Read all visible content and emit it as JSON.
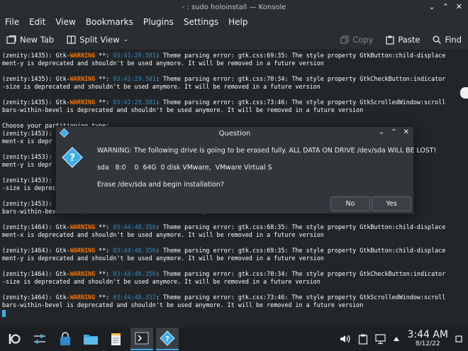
{
  "window": {
    "title": "- : sudo holoinstall — Konsole"
  },
  "menu": [
    "File",
    "Edit",
    "View",
    "Bookmarks",
    "Plugins",
    "Settings",
    "Help"
  ],
  "toolbar": {
    "new_tab": "New Tab",
    "split_view": "Split View",
    "copy": "Copy",
    "paste": "Paste",
    "find": "Find"
  },
  "terminal": {
    "lines": [
      {
        "pid": "(zenity:1435): Gtk-",
        "warn": "WARNING",
        "sep": " **: ",
        "ts": "03:41:29.581",
        "msg": ": Theme parsing error: gtk.css:69:35: The style property GtkButton:child-displace"
      },
      {
        "text": "ment-y is deprecated and shouldn't be used anymore. It will be removed in a future version"
      },
      {
        "text": ""
      },
      {
        "pid": "(zenity:1435): Gtk-",
        "warn": "WARNING",
        "sep": " **: ",
        "ts": "03:41:29.581",
        "msg": ": Theme parsing error: gtk.css:70:34: The style property GtkCheckButton:indicator"
      },
      {
        "text": "-size is deprecated and shouldn't be used anymore. It will be removed in a future version"
      },
      {
        "text": ""
      },
      {
        "pid": "(zenity:1435): Gtk-",
        "warn": "WARNING",
        "sep": " **: ",
        "ts": "03:41:29.581",
        "msg": ": Theme parsing error: gtk.css:73:46: The style property GtkScrolledWindow:scroll"
      },
      {
        "text": "bars-within-bevel is deprecated and shouldn't be used anymore. It will be removed in a future version"
      },
      {
        "text": ""
      },
      {
        "text": "Choose your partitioning type:"
      },
      {
        "text": "(zenity:1453):                                                                                 :child-displace"
      },
      {
        "text": "ment-x is depr"
      },
      {
        "text": ""
      },
      {
        "text": "(zenity:1453):                                                                                 :child-displace"
      },
      {
        "text": "ment-y is depr"
      },
      {
        "text": ""
      },
      {
        "text": "(zenity:1453):                                                                                 n:indicator"
      },
      {
        "text": "-size is deprec"
      },
      {
        "text": ""
      },
      {
        "text": "(zenity:1453):                                                                                 Window:scroll"
      },
      {
        "text": "bars-within-bevel is deprecated and shouldn't be used anymore. It will be removed in a future version"
      },
      {
        "text": ""
      },
      {
        "pid": "(zenity:1464): Gtk-",
        "warn": "WARNING",
        "sep": " **: ",
        "ts": "03:44:48.356",
        "msg": ": Theme parsing error: gtk.css:68:35: The style property GtkButton:child-displace"
      },
      {
        "text": "ment-x is deprecated and shouldn't be used anymore. It will be removed in a future version"
      },
      {
        "text": ""
      },
      {
        "pid": "(zenity:1464): Gtk-",
        "warn": "WARNING",
        "sep": " **: ",
        "ts": "03:44:48.356",
        "msg": ": Theme parsing error: gtk.css:69:35: The style property GtkButton:child-displace"
      },
      {
        "text": "ment-y is deprecated and shouldn't be used anymore. It will be removed in a future version"
      },
      {
        "text": ""
      },
      {
        "pid": "(zenity:1464): Gtk-",
        "warn": "WARNING",
        "sep": " **: ",
        "ts": "03:44:48.356",
        "msg": ": Theme parsing error: gtk.css:70:34: The style property GtkCheckButton:indicator"
      },
      {
        "text": "-size is deprecated and shouldn't be used anymore. It will be removed in a future version"
      },
      {
        "text": ""
      },
      {
        "pid": "(zenity:1464): Gtk-",
        "warn": "WARNING",
        "sep": " **: ",
        "ts": "03:44:48.357",
        "msg": ": Theme parsing error: gtk.css:73:46: The style property GtkScrolledWindow:scroll"
      },
      {
        "text": "bars-within-bevel is deprecated and shouldn't be used anymore. It will be removed in a future version"
      }
    ]
  },
  "dialog": {
    "title": "Question",
    "warning": "WARNING: The following drive is going to be erased fully. ALL DATA ON DRIVE /dev/sda WILL BE LOST!",
    "drive": "sda   8:0    0  64G  0 disk VMware,  VMware Virtual S",
    "question": "Erase /dev/sda and begin installation?",
    "no_label": "No",
    "yes_label": "Yes"
  },
  "taskbar": {
    "time": "3:44 AM",
    "date": "8/12/22"
  },
  "colors": {
    "accent": "#3daee9",
    "warning": "#f67400",
    "timestamp": "#2e89c6"
  }
}
